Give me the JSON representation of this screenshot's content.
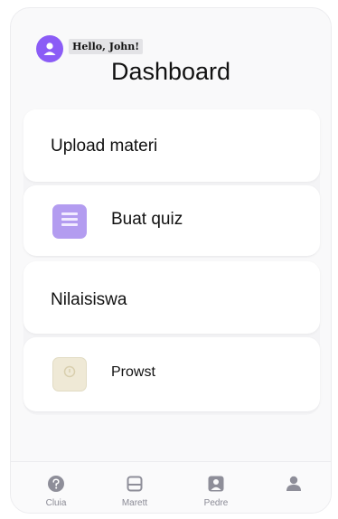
{
  "header": {
    "greeting": "Hello, John!",
    "title": "Dashboard"
  },
  "section1": {
    "title": "Upload materi",
    "item": {
      "label": "Buat quiz",
      "icon": "document-icon"
    }
  },
  "section2": {
    "title": "Nilaisiswa",
    "item": {
      "label": "Prowst",
      "icon": "badge-icon"
    }
  },
  "nav": {
    "items": [
      {
        "label": "Cluia",
        "icon": "help-icon"
      },
      {
        "label": "Marett",
        "icon": "tray-icon"
      },
      {
        "label": "Pedre",
        "icon": "portrait-icon"
      },
      {
        "label": "",
        "icon": "user-icon"
      }
    ]
  },
  "colors": {
    "accent": "#8b5cf6",
    "quiz_icon": "#b39cf0",
    "nav_icon": "#8e8e99"
  }
}
